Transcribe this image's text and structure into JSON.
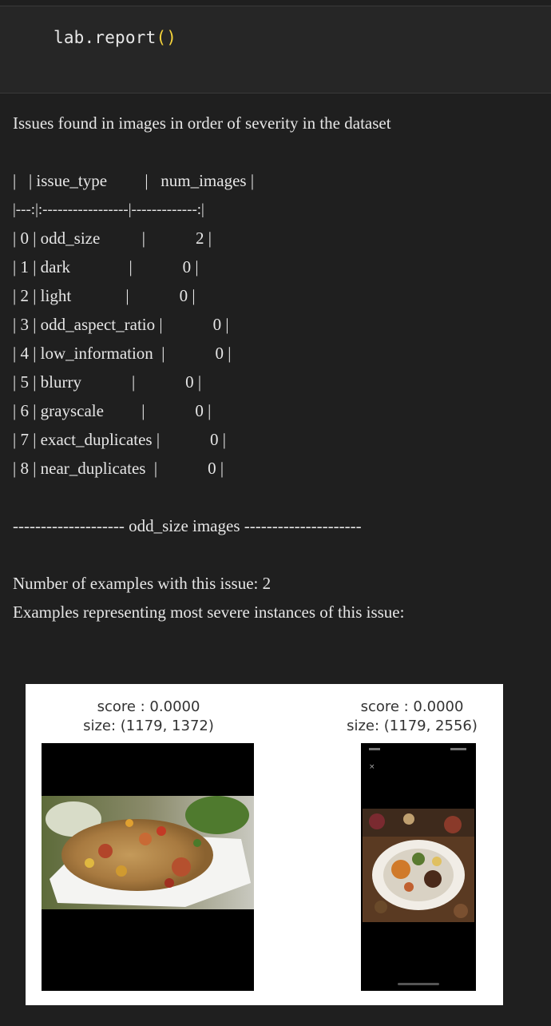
{
  "code": {
    "prefix": "lab.report",
    "paren": "()"
  },
  "report": {
    "heading": "Issues found in images in order of severity in the dataset",
    "table_header": "|   | issue_type         |   num_images |",
    "table_separator": "|---:|:-----------------|-------------:|",
    "rows": [
      "| 0 | odd_size          |            2 |",
      "| 1 | dark              |            0 |",
      "| 2 | light             |            0 |",
      "| 3 | odd_aspect_ratio |            0 |",
      "| 4 | low_information  |            0 |",
      "| 5 | blurry            |            0 |",
      "| 6 | grayscale         |            0 |",
      "| 7 | exact_duplicates |            0 |",
      "| 8 | near_duplicates  |            0 |"
    ],
    "section_title": "-------------------- odd_size images ---------------------",
    "count_line": "Number of examples with this issue: 2",
    "examples_line": "Examples representing most severe instances of this issue:"
  },
  "figure": {
    "images": [
      {
        "score": "score : 0.0000",
        "size": "size: (1179, 1372)",
        "content": "fried-rice-photo"
      },
      {
        "score": "score : 0.0000",
        "size": "size: (1179, 2556)",
        "content": "phone-screenshot-food"
      }
    ]
  }
}
